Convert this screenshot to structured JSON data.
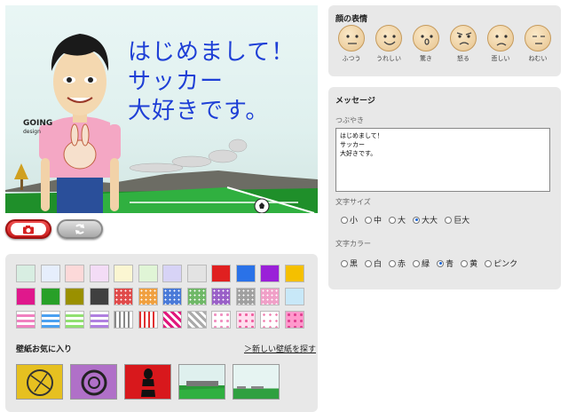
{
  "stage": {
    "speech_text": "はじめまして！\nサッカー\n大好きです。",
    "watermark_title": "GOING",
    "watermark_sub": "design"
  },
  "buttons": {
    "camera_icon": "camera-icon",
    "refresh_icon": "refresh-icon"
  },
  "faces_panel": {
    "title": "顔の表情",
    "faces": [
      {
        "label": "ふつう",
        "icon": "face-normal-icon"
      },
      {
        "label": "うれしい",
        "icon": "face-happy-icon"
      },
      {
        "label": "驚き",
        "icon": "face-surprised-icon"
      },
      {
        "label": "怒る",
        "icon": "face-angry-icon"
      },
      {
        "label": "悲しい",
        "icon": "face-sad-icon"
      },
      {
        "label": "ねむい",
        "icon": "face-sleepy-icon"
      }
    ]
  },
  "message_panel": {
    "title": "メッセージ",
    "tweet_label": "つぶやき",
    "tweet_value": "はじめまして！\nサッカー\n大好きです。",
    "size_label": "文字サイズ",
    "sizes": [
      {
        "label": "小",
        "selected": false
      },
      {
        "label": "中",
        "selected": false
      },
      {
        "label": "大",
        "selected": false
      },
      {
        "label": "大大",
        "selected": true
      },
      {
        "label": "巨大",
        "selected": false
      }
    ],
    "color_label": "文字カラー",
    "colors": [
      {
        "label": "黒",
        "selected": false
      },
      {
        "label": "白",
        "selected": false
      },
      {
        "label": "赤",
        "selected": false
      },
      {
        "label": "緑",
        "selected": false
      },
      {
        "label": "青",
        "selected": true
      },
      {
        "label": "黄",
        "selected": false
      },
      {
        "label": "ピンク",
        "selected": false
      }
    ]
  },
  "wallpaper_panel": {
    "swatch_colors": [
      "#d8eee2",
      "#e6eefc",
      "#fcd9d9",
      "#f3dcf6",
      "#fbf6d2",
      "#e0f5d6",
      "#d7d3f6",
      "#e3e3e3",
      "#e02020",
      "#2a72e8",
      "#9a20d8",
      "#f5c000",
      "#e0188c",
      "#28a028",
      "#9a9000",
      "#404040",
      "#e04a4a",
      "#f0a040",
      "#4a7ad8",
      "#70b868",
      "#9a60c8",
      "#a0a0a0",
      "#f0a0c8",
      "#c8e8f8"
    ],
    "favorites_title": "壁紙お気に入り",
    "more_link": "＞新しい壁紙を探す",
    "thumbnails": [
      "wallpaper-thumb-yellow",
      "wallpaper-thumb-purple",
      "wallpaper-thumb-red",
      "wallpaper-thumb-stadium",
      "wallpaper-thumb-field"
    ]
  }
}
